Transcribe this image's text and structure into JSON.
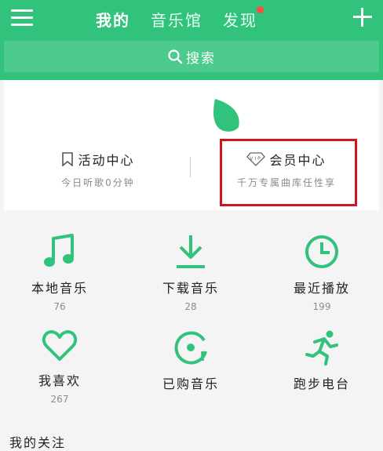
{
  "header": {
    "tabs": [
      {
        "label": "我的",
        "active": true
      },
      {
        "label": "音乐馆",
        "active": false
      },
      {
        "label": "发现",
        "active": false,
        "badge": true
      }
    ],
    "icons": {
      "menu": "hamburger-menu-icon",
      "add": "plus-icon"
    },
    "accent_color": "#31c27c"
  },
  "search": {
    "label": "搜索",
    "icon": "search-icon"
  },
  "member_card": {
    "activity": {
      "title": "活动中心",
      "subtitle": "今日听歌0分钟",
      "icon": "bookmark-icon"
    },
    "vip": {
      "title": "会员中心",
      "subtitle": "千万专属曲库任性享",
      "icon": "vip-diamond-icon"
    },
    "highlight_color": "#d2141e"
  },
  "grid": [
    {
      "label": "本地音乐",
      "count": "76",
      "icon": "music-note-icon"
    },
    {
      "label": "下载音乐",
      "count": "28",
      "icon": "download-icon"
    },
    {
      "label": "最近播放",
      "count": "199",
      "icon": "clock-icon"
    },
    {
      "label": "我喜欢",
      "count": "267",
      "icon": "heart-icon"
    },
    {
      "label": "已购音乐",
      "count": "",
      "icon": "purchased-disc-icon"
    },
    {
      "label": "跑步电台",
      "count": "",
      "icon": "running-person-icon"
    }
  ],
  "follow_section": {
    "title": "我的关注"
  }
}
